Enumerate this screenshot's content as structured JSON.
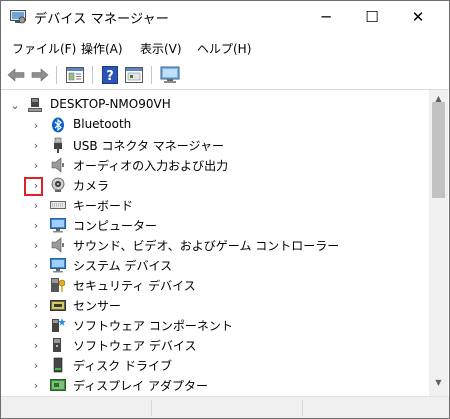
{
  "window": {
    "title": "デバイス マネージャー",
    "minimize_glyph": "─",
    "maximize_glyph": "☐",
    "close_glyph": "✕"
  },
  "menu": [
    {
      "label": "ファイル(F)"
    },
    {
      "label": "操作(A)"
    },
    {
      "label": "表示(V)"
    },
    {
      "label": "ヘルプ(H)"
    }
  ],
  "toolbar": {
    "back_icon": "back-arrow-icon",
    "forward_icon": "forward-arrow-icon",
    "properties_icon": "properties-icon",
    "help_icon": "help-icon",
    "update_icon": "update-driver-icon",
    "scan_icon": "monitor-scan-icon"
  },
  "tree": {
    "root": {
      "label": "DESKTOP-NMO90VH",
      "expanded": true,
      "icon": "computer-icon"
    },
    "items": [
      {
        "label": "Bluetooth",
        "icon": "bluetooth-icon"
      },
      {
        "label": "USB コネクタ マネージャー",
        "icon": "usb-connector-icon"
      },
      {
        "label": "オーディオの入力および出力",
        "icon": "speaker-icon"
      },
      {
        "label": "カメラ",
        "icon": "camera-icon"
      },
      {
        "label": "キーボード",
        "icon": "keyboard-icon"
      },
      {
        "label": "コンピューター",
        "icon": "computer-monitor-icon"
      },
      {
        "label": "サウンド、ビデオ、およびゲーム コントローラー",
        "icon": "sound-icon"
      },
      {
        "label": "システム デバイス",
        "icon": "system-device-icon"
      },
      {
        "label": "セキュリティ デバイス",
        "icon": "security-key-icon"
      },
      {
        "label": "センサー",
        "icon": "sensor-icon"
      },
      {
        "label": "ソフトウェア コンポーネント",
        "icon": "software-component-icon"
      },
      {
        "label": "ソフトウェア デバイス",
        "icon": "software-device-icon"
      },
      {
        "label": "ディスク ドライブ",
        "icon": "disk-drive-icon"
      },
      {
        "label": "ディスプレイ アダプター",
        "icon": "display-adapter-icon"
      }
    ]
  },
  "highlighted_item": "カメラ",
  "colors": {
    "highlight_border": "#e0202a",
    "bluetooth": "#0a64c8",
    "window_border": "#6d6d6d"
  }
}
